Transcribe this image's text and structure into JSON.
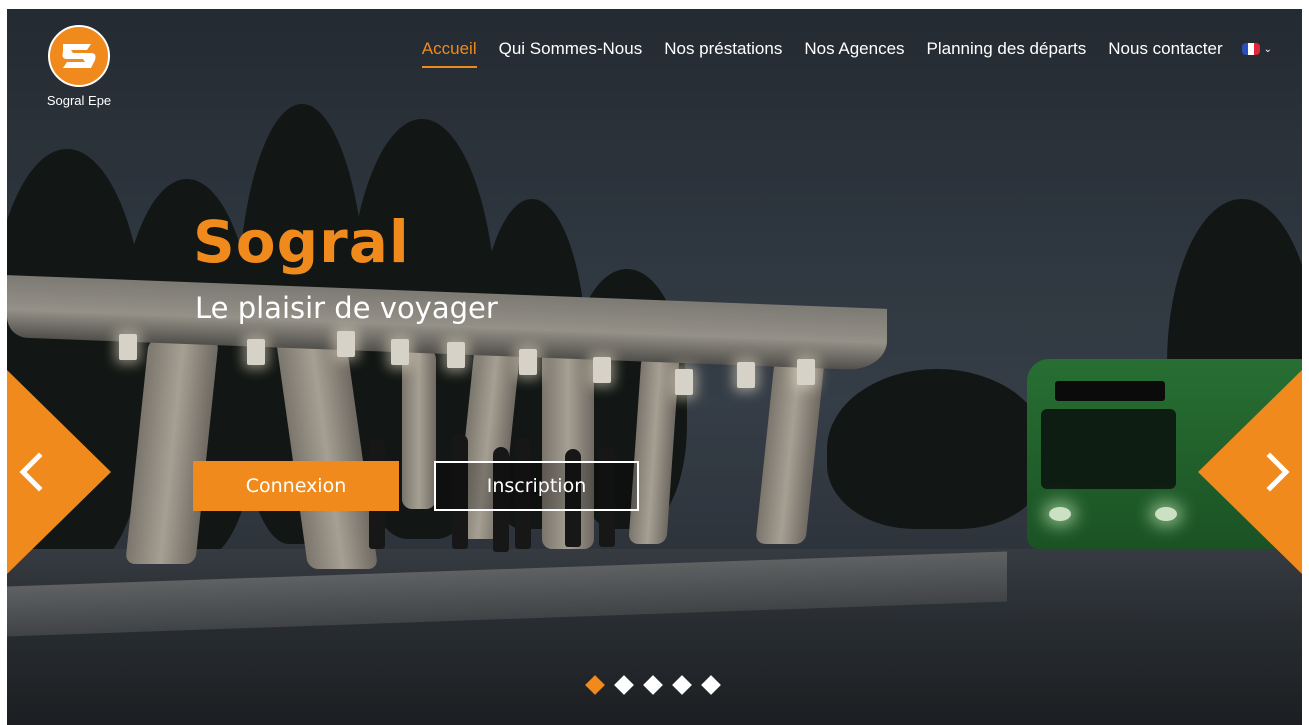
{
  "brand": {
    "name": "Sogral Epe",
    "accent_color": "#f08a1c",
    "logo_icon": "bus-logo-icon"
  },
  "nav": {
    "items": [
      {
        "label": "Accueil",
        "active": true
      },
      {
        "label": "Qui Sommes-Nous",
        "active": false
      },
      {
        "label": "Nos préstations",
        "active": false
      },
      {
        "label": "Nos Agences",
        "active": false
      },
      {
        "label": "Planning des départs",
        "active": false
      },
      {
        "label": "Nous contacter",
        "active": false
      }
    ],
    "language": {
      "icon": "france-flag-icon",
      "dropdown_icon": "chevron-down-icon"
    }
  },
  "hero": {
    "title": "Sogral",
    "subtitle": "Le plaisir de voyager",
    "login_label": "Connexion",
    "register_label": "Inscription"
  },
  "carousel": {
    "prev_icon": "chevron-left-icon",
    "next_icon": "chevron-right-icon",
    "slide_count": 5,
    "active_slide": 1
  }
}
